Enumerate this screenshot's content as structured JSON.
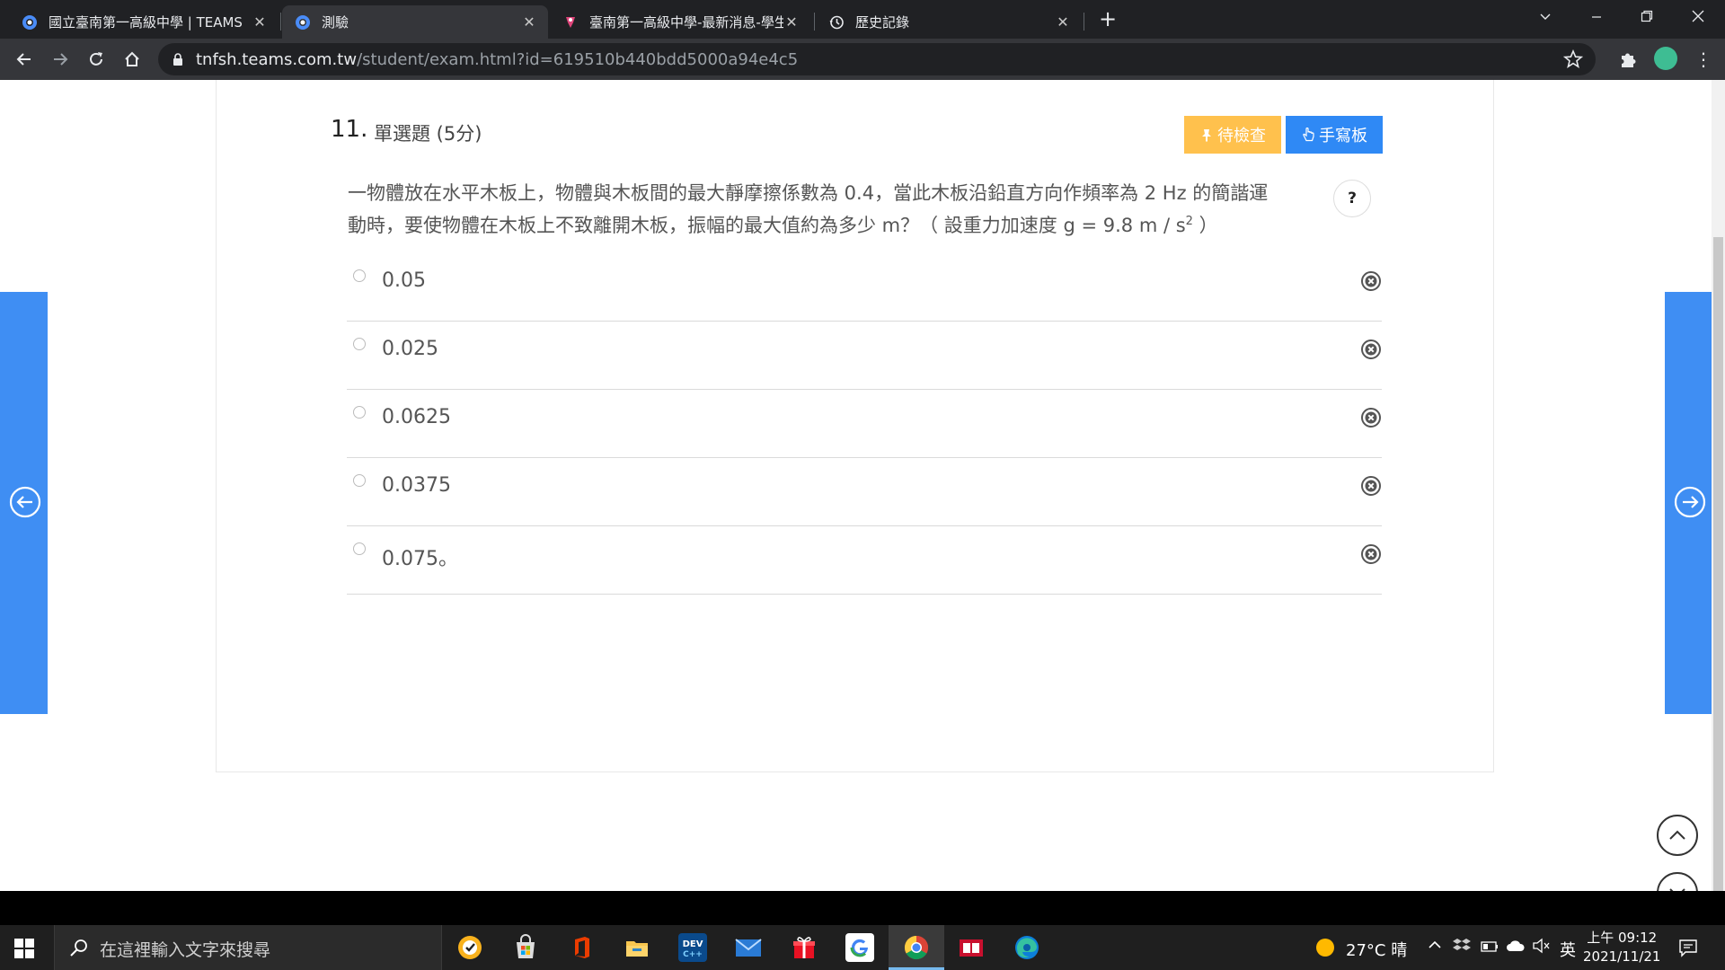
{
  "browser": {
    "tabs": [
      {
        "label": "國立臺南第一高級中學 | TEAMS",
        "icon": "teams-icon",
        "active": false
      },
      {
        "label": "測驗",
        "icon": "teams-icon",
        "active": true
      },
      {
        "label": "臺南第一高級中學-最新消息-學生",
        "icon": "school-icon",
        "active": false
      },
      {
        "label": "歷史記錄",
        "icon": "history-icon",
        "active": false
      }
    ],
    "url_host": "tnfsh.teams.com.tw",
    "url_path": "/student/exam.html?id=619510b440bdd5000a94e4c5"
  },
  "question": {
    "number": "11.",
    "type": "單選題 (5分)",
    "text_line1": "一物體放在水平木板上，物體與木板間的最大靜摩擦係數為 0.4，當此木板沿鉛直方向作頻率為 2 Hz 的簡諧運",
    "text_line2": "動時，要使物體在木板上不致離開木板，振幅的最大值約為多少 m？（ 設重力加速度 g = 9.8 m / s",
    "text_sup": "2",
    "text_end": " ）",
    "help_label": "?",
    "options": [
      "0.05",
      "0.025",
      "0.0625",
      "0.0375",
      "0.075。"
    ]
  },
  "buttons": {
    "pending_label": "待檢查",
    "handwriting_label": "手寫板"
  },
  "taskbar": {
    "search_placeholder": "在這裡輸入文字來搜尋",
    "weather": "27°C 晴",
    "ime": "英",
    "time": "上午 09:12",
    "date": "2021/11/21"
  },
  "colors": {
    "accent_blue": "#3f8ef3",
    "pending_orange": "#ffc14d",
    "handwriting_blue": "#2f89f5"
  }
}
